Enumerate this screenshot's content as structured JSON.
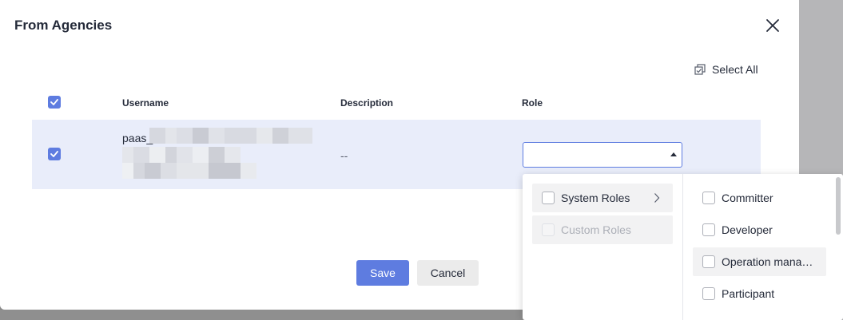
{
  "dialog": {
    "title": "From Agencies",
    "select_all_label": "Select All"
  },
  "table": {
    "columns": [
      "Username",
      "Description",
      "Role"
    ],
    "rows": [
      {
        "selected": true,
        "username_visible": "paas_",
        "description": "--",
        "role": ""
      }
    ]
  },
  "footer": {
    "save_label": "Save",
    "cancel_label": "Cancel"
  },
  "role_dropdown": {
    "categories": [
      {
        "label": "System Roles",
        "has_children": true,
        "disabled": false,
        "checked": false
      },
      {
        "label": "Custom Roles",
        "has_children": false,
        "disabled": true,
        "checked": false
      }
    ],
    "roles": [
      {
        "label": "Committer",
        "checked": false
      },
      {
        "label": "Developer",
        "checked": false
      },
      {
        "label": "Operation mana…",
        "checked": false
      },
      {
        "label": "Participant",
        "checked": false
      }
    ]
  },
  "colors": {
    "accent": "#5e7ce0",
    "selected_row": "#e9edfa",
    "text": "#252b3a"
  },
  "icons": [
    "close-icon",
    "select-all-icon",
    "checkmark-icon",
    "caret-up-icon",
    "chevron-right-icon"
  ]
}
